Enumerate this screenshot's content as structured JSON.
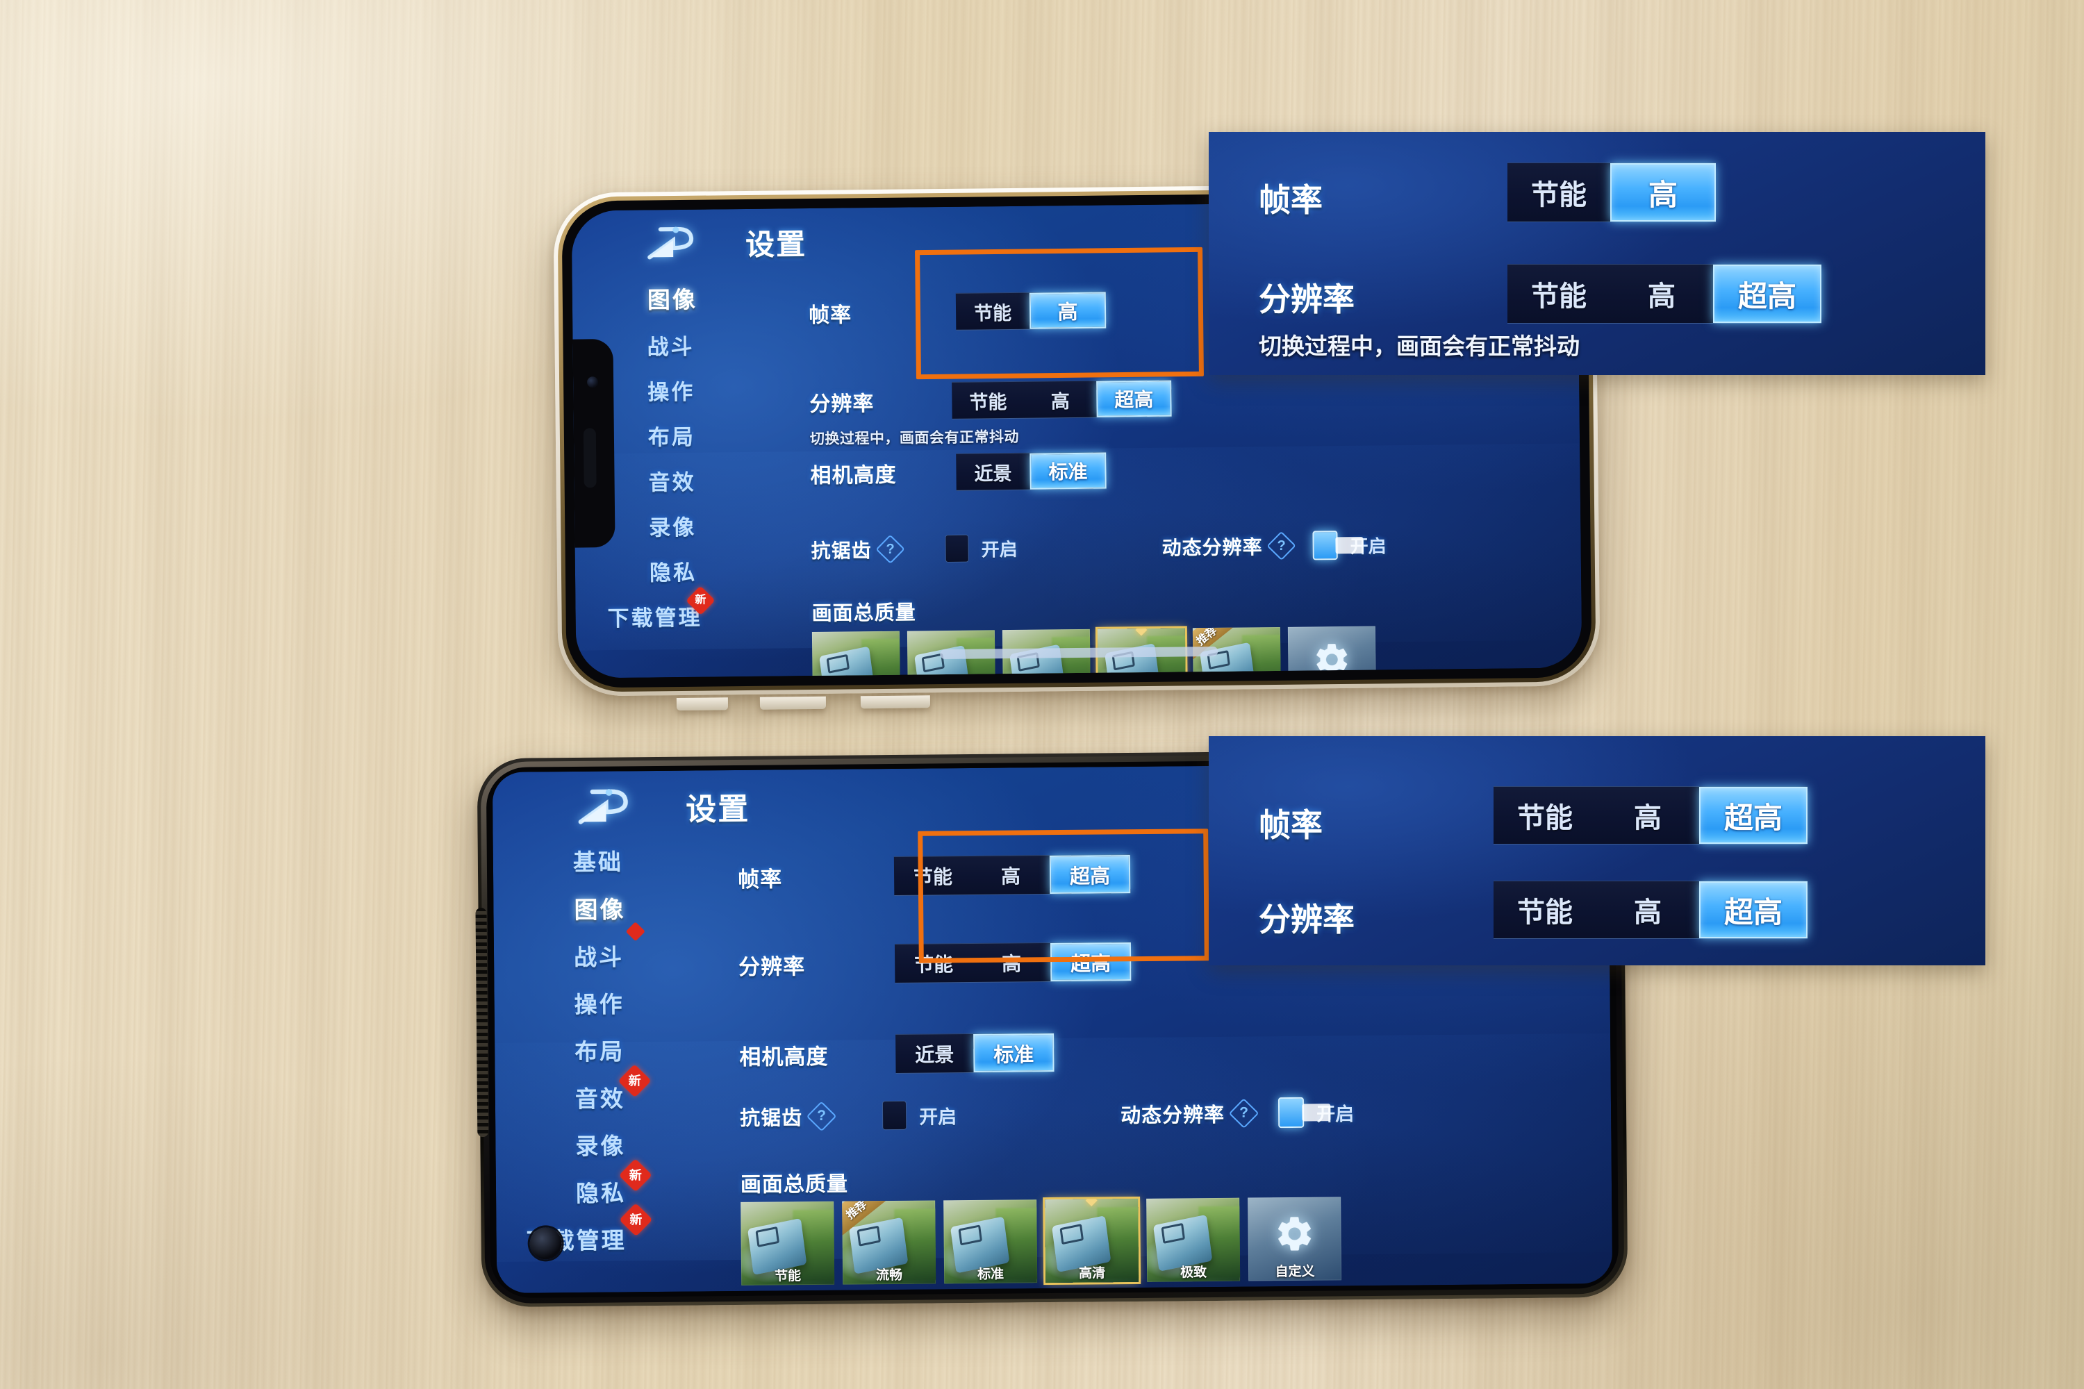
{
  "scene": {
    "description": "Two smartphones on a light wood desk showing the Honor of Kings graphics settings screen, with two zoomed callout panels",
    "accent_blue": "#49b2ff",
    "panel_blue": "#153581",
    "highlight_orange": "#f0700f",
    "desk_color": "#e8d9bd"
  },
  "game_ui": {
    "back_icon": "back-arrow-icon",
    "title": "设置",
    "nav_top": [
      {
        "label": "图像",
        "active": true,
        "badge": ""
      },
      {
        "label": "战斗",
        "active": false,
        "badge": ""
      },
      {
        "label": "操作",
        "active": false,
        "badge": ""
      },
      {
        "label": "布局",
        "active": false,
        "badge": ""
      },
      {
        "label": "音效",
        "active": false,
        "badge": ""
      },
      {
        "label": "录像",
        "active": false,
        "badge": ""
      },
      {
        "label": "隐私",
        "active": false,
        "badge": ""
      },
      {
        "label": "下载管理",
        "active": false,
        "badge": "新"
      }
    ],
    "nav_bottom": [
      {
        "label": "基础",
        "active": false,
        "badge": ""
      },
      {
        "label": "图像",
        "active": true,
        "badge": ""
      },
      {
        "label": "战斗",
        "active": false,
        "badge": ""
      },
      {
        "label": "操作",
        "active": false,
        "badge": ""
      },
      {
        "label": "布局",
        "active": false,
        "badge": ""
      },
      {
        "label": "音效",
        "active": false,
        "badge": "新"
      },
      {
        "label": "录像",
        "active": false,
        "badge": ""
      },
      {
        "label": "隐私",
        "active": false,
        "badge": "新"
      },
      {
        "label": "下载管理",
        "active": false,
        "badge": "新"
      }
    ],
    "rows": {
      "framerate_label": "帧率",
      "resolution_label": "分辨率",
      "resolution_note": "切换过程中，画面会有正常抖动",
      "camera_label": "相机高度",
      "antialias_label": "抗锯齿",
      "antialias_value": "开启",
      "dynres_label": "动态分辨率",
      "dynres_value": "开启",
      "quality_label": "画面总质量",
      "help_icon": "question-mark-icon"
    },
    "options": {
      "eco": "节能",
      "high": "高",
      "ultra": "超高",
      "close": "近景",
      "standard": "标准"
    },
    "quality_presets": [
      {
        "label": "节能",
        "selected": false,
        "recommended": false
      },
      {
        "label": "流畅",
        "selected": false,
        "recommended": false
      },
      {
        "label": "标准",
        "selected": false,
        "recommended": false
      },
      {
        "label": "高清",
        "selected": true,
        "recommended": false
      },
      {
        "label": "极致",
        "selected": false,
        "recommended": true
      },
      {
        "label": "自定义",
        "selected": false,
        "recommended": false,
        "icon": "gear-icon"
      }
    ],
    "recommend_tag": "推荐"
  },
  "phone_top": {
    "device": "white-iphone-landscape",
    "framerate_selected": "高",
    "framerate_options": [
      "节能",
      "高"
    ],
    "resolution_selected": "超高",
    "resolution_options": [
      "节能",
      "高",
      "超高"
    ],
    "camera_selected": "标准",
    "camera_options": [
      "近景",
      "标准"
    ],
    "antialias_on": false,
    "dynres_on": true
  },
  "phone_bottom": {
    "device": "black-android-landscape",
    "framerate_selected": "超高",
    "framerate_options": [
      "节能",
      "高",
      "超高"
    ],
    "resolution_selected": "超高",
    "resolution_options": [
      "节能",
      "高",
      "超高"
    ],
    "camera_selected": "标准",
    "camera_options": [
      "近景",
      "标准"
    ],
    "antialias_on": false,
    "dynres_on": true
  },
  "callout_top": {
    "framerate_label": "帧率",
    "framerate_options": [
      "节能",
      "高"
    ],
    "framerate_selected": "高",
    "resolution_label": "分辨率",
    "resolution_options": [
      "节能",
      "高",
      "超高"
    ],
    "resolution_selected": "超高",
    "note": "切换过程中，画面会有正常抖动"
  },
  "callout_bottom": {
    "framerate_label": "帧率",
    "framerate_options": [
      "节能",
      "高",
      "超高"
    ],
    "framerate_selected": "超高",
    "resolution_label": "分辨率",
    "resolution_options": [
      "节能",
      "高",
      "超高"
    ],
    "resolution_selected": "超高"
  }
}
